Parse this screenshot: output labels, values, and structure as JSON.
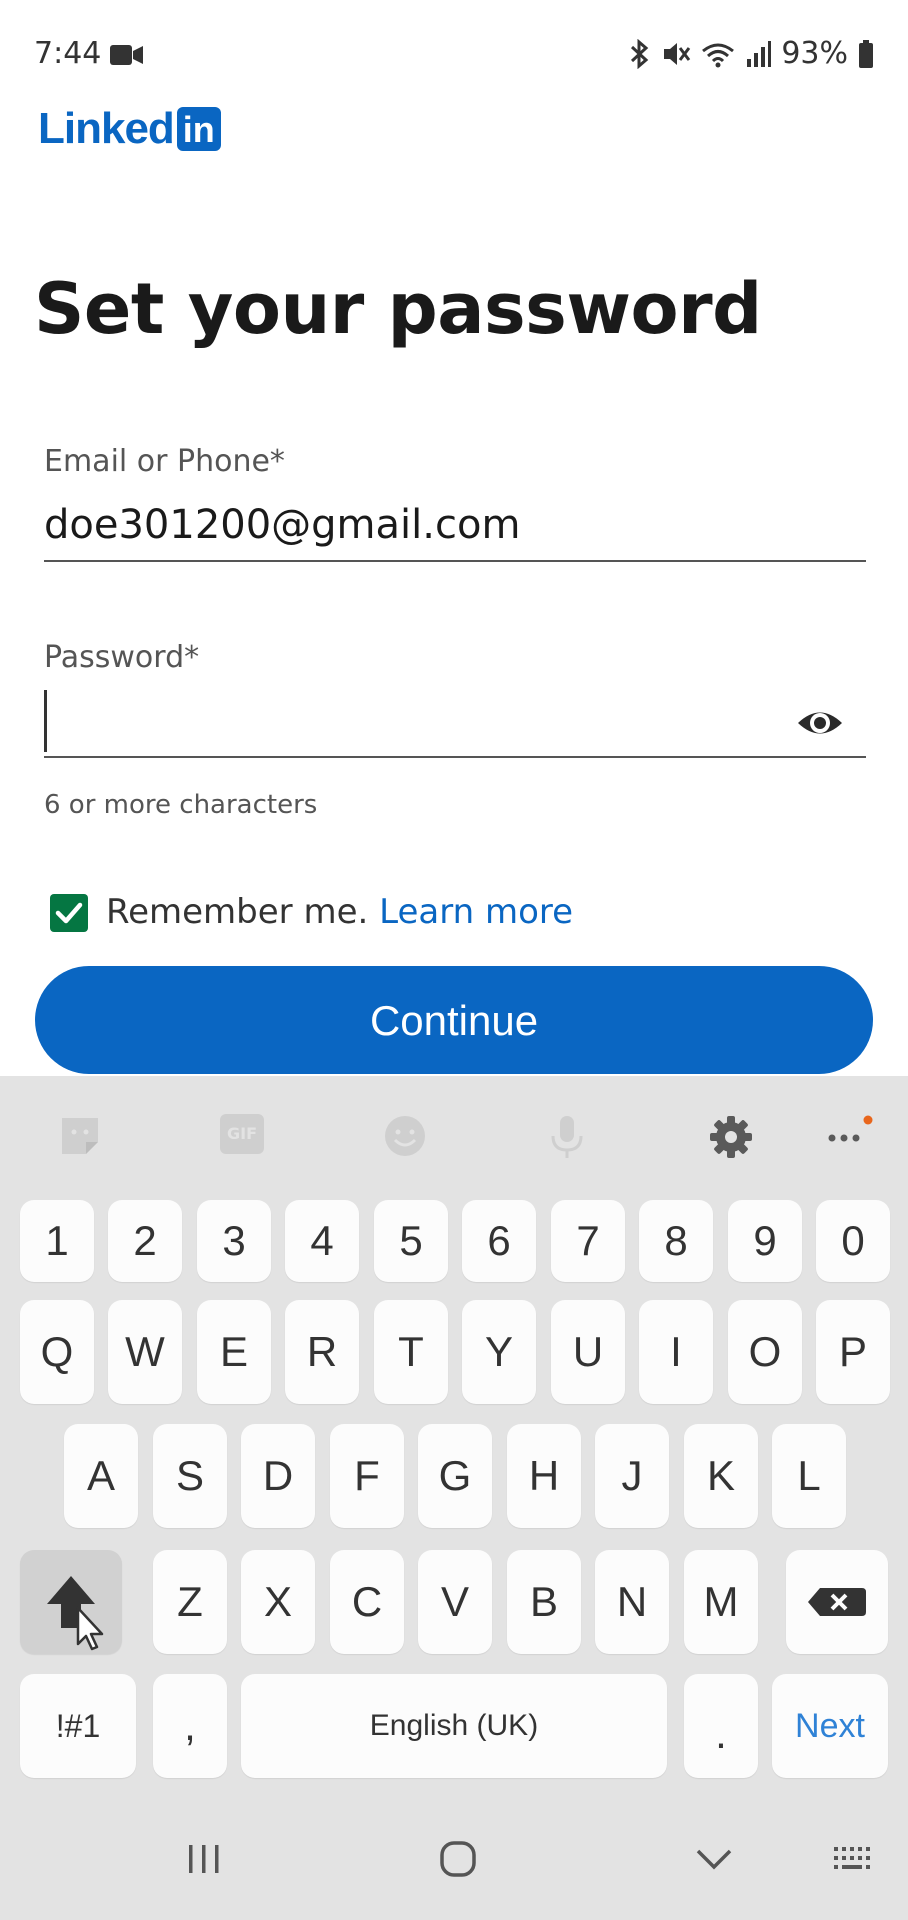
{
  "status_bar": {
    "time": "7:44",
    "battery": "93%"
  },
  "logo": {
    "text": "Linked",
    "box": "in"
  },
  "title": "Set your password",
  "form": {
    "email_label": "Email or Phone*",
    "email_value": "doe301200@gmail.com",
    "password_label": "Password*",
    "password_hint": "6 or more characters",
    "remember_label": "Remember me.",
    "learn_more": "Learn more",
    "continue_label": "Continue"
  },
  "keyboard": {
    "row_numbers": [
      "1",
      "2",
      "3",
      "4",
      "5",
      "6",
      "7",
      "8",
      "9",
      "0"
    ],
    "row_q": [
      "Q",
      "W",
      "E",
      "R",
      "T",
      "Y",
      "U",
      "I",
      "O",
      "P"
    ],
    "row_a": [
      "A",
      "S",
      "D",
      "F",
      "G",
      "H",
      "J",
      "K",
      "L"
    ],
    "row_z": [
      "Z",
      "X",
      "C",
      "V",
      "B",
      "N",
      "M"
    ],
    "symbols_key": "!#1",
    "comma_key": ",",
    "space_key": "English (UK)",
    "period_key": ".",
    "next_key": "Next",
    "toolbar_gif": "GIF"
  },
  "colors": {
    "brand": "#0a66c2",
    "checkbox": "#057642",
    "next": "#2f82d6"
  }
}
